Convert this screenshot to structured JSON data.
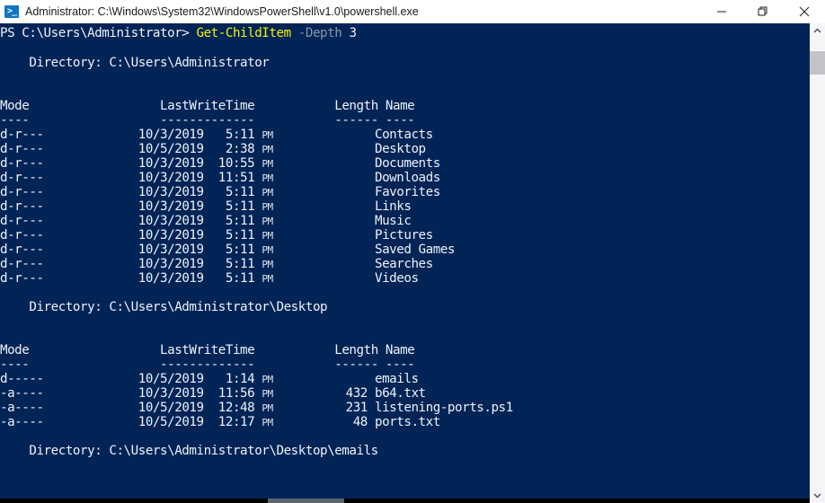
{
  "window": {
    "title": "Administrator: C:\\Windows\\System32\\WindowsPowerShell\\v1.0\\powershell.exe",
    "icon": "powershell-icon",
    "icon_glyph": ">_",
    "background_color": "#012456",
    "titlebar_color": "#ffffff",
    "controls": {
      "minimize_label": "Minimize",
      "restore_label": "Restore",
      "close_label": "Close"
    }
  },
  "colors": {
    "console_background": "#012456",
    "default_text": "#eef2f8",
    "command_yellow": "#f2f20c",
    "parameter_gray": "#8a96a8",
    "scrollbar_track": "#f7f4f7",
    "scrollbar_thumb": "#c3c3c7"
  },
  "console": {
    "prompt": {
      "prefix": "PS C:\\Users\\Administrator>",
      "command": "Get-ChildItem",
      "parameter": "-Depth",
      "argument": "3"
    },
    "column_headers": {
      "mode": "Mode",
      "lastwritetime": "LastWriteTime",
      "length": "Length",
      "name": "Name",
      "mode_rule": "----",
      "lastwritetime_rule": "-------------",
      "length_rule": "------",
      "name_rule": "----"
    },
    "sections": [
      {
        "directory_label": "Directory:",
        "directory_path": "C:\\Users\\Administrator",
        "rows": [
          {
            "mode": "d-r---",
            "date": "10/3/2019",
            "time": "5:11",
            "meridiem": "PM",
            "length": "",
            "name": "Contacts"
          },
          {
            "mode": "d-r---",
            "date": "10/5/2019",
            "time": "2:38",
            "meridiem": "PM",
            "length": "",
            "name": "Desktop"
          },
          {
            "mode": "d-r---",
            "date": "10/3/2019",
            "time": "10:55",
            "meridiem": "PM",
            "length": "",
            "name": "Documents"
          },
          {
            "mode": "d-r---",
            "date": "10/3/2019",
            "time": "11:51",
            "meridiem": "PM",
            "length": "",
            "name": "Downloads"
          },
          {
            "mode": "d-r---",
            "date": "10/3/2019",
            "time": "5:11",
            "meridiem": "PM",
            "length": "",
            "name": "Favorites"
          },
          {
            "mode": "d-r---",
            "date": "10/3/2019",
            "time": "5:11",
            "meridiem": "PM",
            "length": "",
            "name": "Links"
          },
          {
            "mode": "d-r---",
            "date": "10/3/2019",
            "time": "5:11",
            "meridiem": "PM",
            "length": "",
            "name": "Music"
          },
          {
            "mode": "d-r---",
            "date": "10/3/2019",
            "time": "5:11",
            "meridiem": "PM",
            "length": "",
            "name": "Pictures"
          },
          {
            "mode": "d-r---",
            "date": "10/3/2019",
            "time": "5:11",
            "meridiem": "PM",
            "length": "",
            "name": "Saved Games"
          },
          {
            "mode": "d-r---",
            "date": "10/3/2019",
            "time": "5:11",
            "meridiem": "PM",
            "length": "",
            "name": "Searches"
          },
          {
            "mode": "d-r---",
            "date": "10/3/2019",
            "time": "5:11",
            "meridiem": "PM",
            "length": "",
            "name": "Videos"
          }
        ]
      },
      {
        "directory_label": "Directory:",
        "directory_path": "C:\\Users\\Administrator\\Desktop",
        "rows": [
          {
            "mode": "d-----",
            "date": "10/5/2019",
            "time": "1:14",
            "meridiem": "PM",
            "length": "",
            "name": "emails"
          },
          {
            "mode": "-a----",
            "date": "10/3/2019",
            "time": "11:56",
            "meridiem": "PM",
            "length": "432",
            "name": "b64.txt"
          },
          {
            "mode": "-a----",
            "date": "10/5/2019",
            "time": "12:48",
            "meridiem": "PM",
            "length": "231",
            "name": "listening-ports.ps1"
          },
          {
            "mode": "-a----",
            "date": "10/5/2019",
            "time": "12:17",
            "meridiem": "PM",
            "length": "48",
            "name": "ports.txt"
          }
        ]
      },
      {
        "directory_label": "Directory:",
        "directory_path": "C:\\Users\\Administrator\\Desktop\\emails",
        "rows": []
      }
    ]
  },
  "scrollbars": {
    "vertical": {
      "up_arrow": "scroll-up-arrow",
      "down_arrow": "scroll-down-arrow",
      "thumb_position_percent": 3
    },
    "horizontal": {
      "thumb_position_percent": 33
    }
  }
}
